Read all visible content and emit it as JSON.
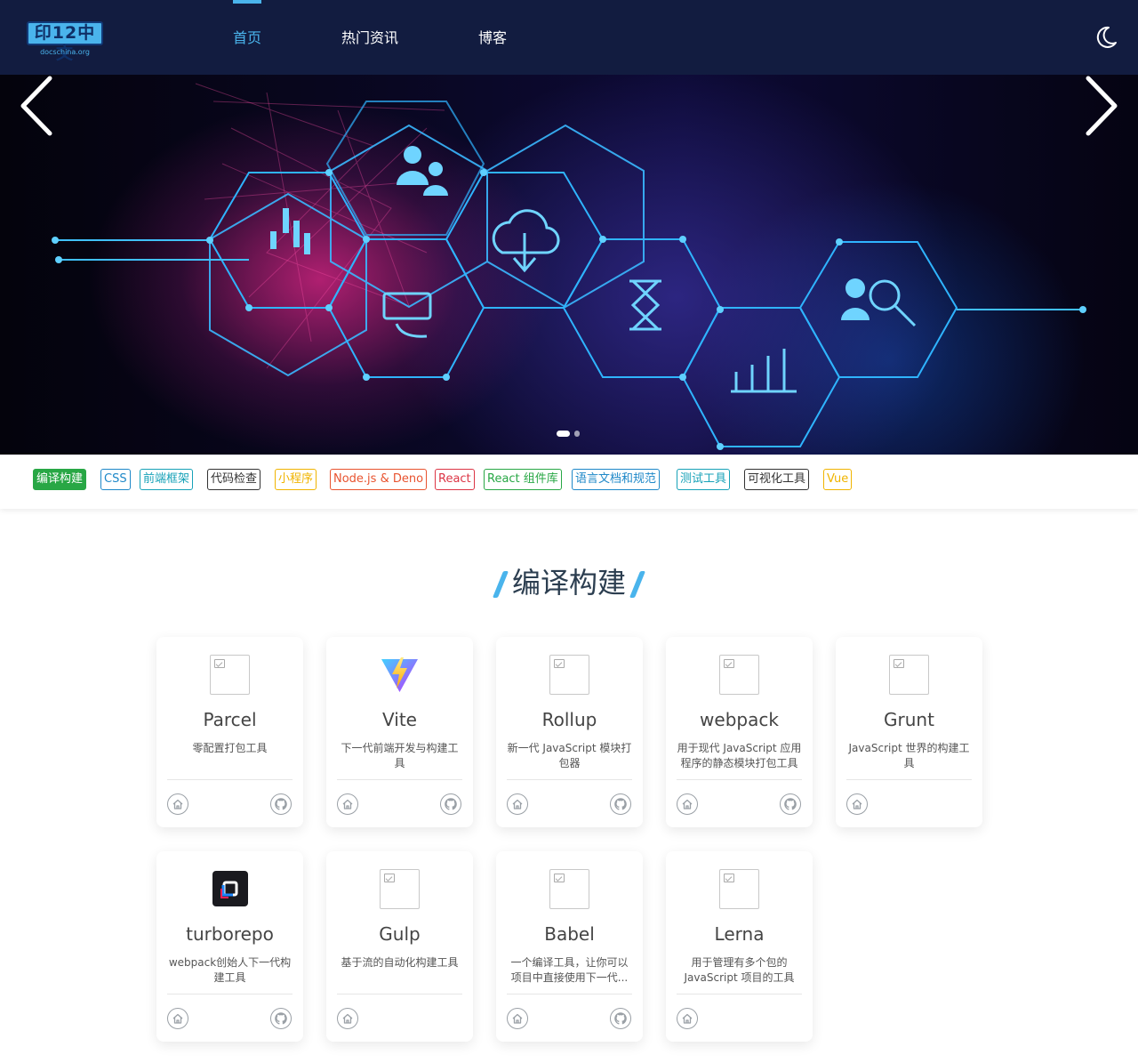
{
  "header": {
    "logo_text": "印12中文",
    "logo_sub": "docschina.org",
    "nav": [
      {
        "label": "首页",
        "active": true
      },
      {
        "label": "热门资讯",
        "active": false
      },
      {
        "label": "博客",
        "active": false
      }
    ],
    "theme_icon": "moon-icon"
  },
  "carousel": {
    "prev_icon": "chevron-left-icon",
    "next_icon": "chevron-right-icon",
    "slide_count": 2,
    "active_slide": 1
  },
  "tags": [
    {
      "label": "编译构建",
      "color": "#28a745",
      "active": true
    },
    {
      "label": "CSS",
      "color": "#1e88c8",
      "active": false
    },
    {
      "label": "前端框架",
      "color": "#17a2b8",
      "active": false
    },
    {
      "label": "代码检查",
      "color": "#333333",
      "active": false
    },
    {
      "label": "小程序",
      "color": "#f0b400",
      "active": false
    },
    {
      "label": "Node.js & Deno",
      "color": "#e8532f",
      "active": false
    },
    {
      "label": "React",
      "color": "#dc3545",
      "active": false
    },
    {
      "label": "React 组件库",
      "color": "#28a745",
      "active": false
    },
    {
      "label": "语言文档和规范",
      "color": "#1e88c8",
      "active": false
    },
    {
      "label": "测试工具",
      "color": "#17a2b8",
      "active": false
    },
    {
      "label": "可视化工具",
      "color": "#333333",
      "active": false
    },
    {
      "label": "Vue",
      "color": "#f0b400",
      "active": false
    }
  ],
  "section": {
    "title": "编译构建"
  },
  "cards": [
    {
      "name": "Parcel",
      "desc": "零配置打包工具",
      "logo": "image-placeholder-icon",
      "github": true
    },
    {
      "name": "Vite",
      "desc": "下一代前端开发与构建工具",
      "logo": "vite-logo-icon",
      "github": true
    },
    {
      "name": "Rollup",
      "desc": "新一代 JavaScript 模块打包器",
      "logo": "image-placeholder-icon",
      "github": true
    },
    {
      "name": "webpack",
      "desc": "用于现代 JavaScript 应用程序的静态模块打包工具",
      "logo": "image-placeholder-icon",
      "github": true
    },
    {
      "name": "Grunt",
      "desc": "JavaScript 世界的构建工具",
      "logo": "image-placeholder-icon",
      "github": false
    },
    {
      "name": "turborepo",
      "desc": "webpack创始人下一代构建工具",
      "logo": "turborepo-logo-icon",
      "github": true
    },
    {
      "name": "Gulp",
      "desc": "基于流的自动化构建工具",
      "logo": "image-placeholder-icon",
      "github": false
    },
    {
      "name": "Babel",
      "desc": "一个编译工具，让你可以项目中直接使用下一代...",
      "logo": "image-placeholder-icon",
      "github": true
    },
    {
      "name": "Lerna",
      "desc": "用于管理有多个包的 JavaScript 项目的工具",
      "logo": "image-placeholder-icon",
      "github": false
    }
  ]
}
